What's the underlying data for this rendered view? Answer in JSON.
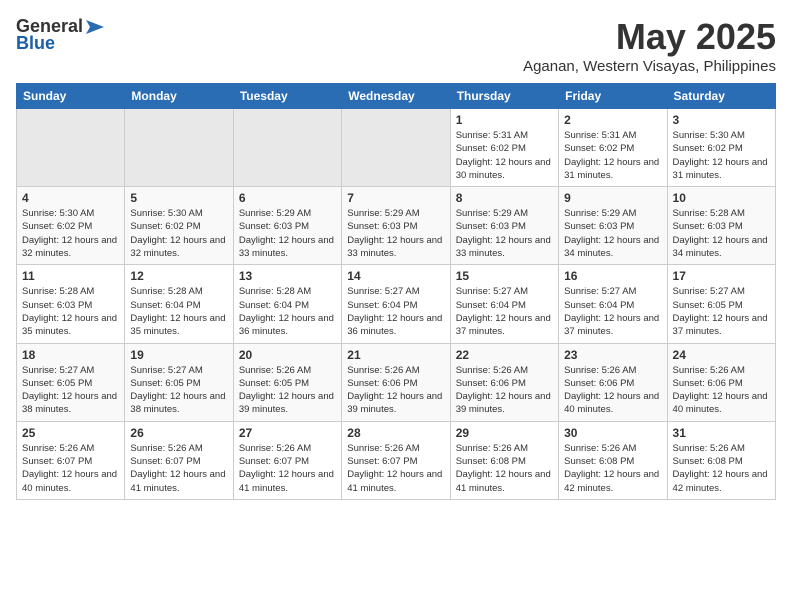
{
  "header": {
    "logo_general": "General",
    "logo_blue": "Blue",
    "month": "May 2025",
    "location": "Aganan, Western Visayas, Philippines"
  },
  "weekdays": [
    "Sunday",
    "Monday",
    "Tuesday",
    "Wednesday",
    "Thursday",
    "Friday",
    "Saturday"
  ],
  "weeks": [
    [
      {
        "day": "",
        "sunrise": "",
        "sunset": "",
        "daylight": "",
        "empty": true
      },
      {
        "day": "",
        "sunrise": "",
        "sunset": "",
        "daylight": "",
        "empty": true
      },
      {
        "day": "",
        "sunrise": "",
        "sunset": "",
        "daylight": "",
        "empty": true
      },
      {
        "day": "",
        "sunrise": "",
        "sunset": "",
        "daylight": "",
        "empty": true
      },
      {
        "day": "1",
        "sunrise": "Sunrise: 5:31 AM",
        "sunset": "Sunset: 6:02 PM",
        "daylight": "Daylight: 12 hours and 30 minutes.",
        "empty": false
      },
      {
        "day": "2",
        "sunrise": "Sunrise: 5:31 AM",
        "sunset": "Sunset: 6:02 PM",
        "daylight": "Daylight: 12 hours and 31 minutes.",
        "empty": false
      },
      {
        "day": "3",
        "sunrise": "Sunrise: 5:30 AM",
        "sunset": "Sunset: 6:02 PM",
        "daylight": "Daylight: 12 hours and 31 minutes.",
        "empty": false
      }
    ],
    [
      {
        "day": "4",
        "sunrise": "Sunrise: 5:30 AM",
        "sunset": "Sunset: 6:02 PM",
        "daylight": "Daylight: 12 hours and 32 minutes.",
        "empty": false
      },
      {
        "day": "5",
        "sunrise": "Sunrise: 5:30 AM",
        "sunset": "Sunset: 6:02 PM",
        "daylight": "Daylight: 12 hours and 32 minutes.",
        "empty": false
      },
      {
        "day": "6",
        "sunrise": "Sunrise: 5:29 AM",
        "sunset": "Sunset: 6:03 PM",
        "daylight": "Daylight: 12 hours and 33 minutes.",
        "empty": false
      },
      {
        "day": "7",
        "sunrise": "Sunrise: 5:29 AM",
        "sunset": "Sunset: 6:03 PM",
        "daylight": "Daylight: 12 hours and 33 minutes.",
        "empty": false
      },
      {
        "day": "8",
        "sunrise": "Sunrise: 5:29 AM",
        "sunset": "Sunset: 6:03 PM",
        "daylight": "Daylight: 12 hours and 33 minutes.",
        "empty": false
      },
      {
        "day": "9",
        "sunrise": "Sunrise: 5:29 AM",
        "sunset": "Sunset: 6:03 PM",
        "daylight": "Daylight: 12 hours and 34 minutes.",
        "empty": false
      },
      {
        "day": "10",
        "sunrise": "Sunrise: 5:28 AM",
        "sunset": "Sunset: 6:03 PM",
        "daylight": "Daylight: 12 hours and 34 minutes.",
        "empty": false
      }
    ],
    [
      {
        "day": "11",
        "sunrise": "Sunrise: 5:28 AM",
        "sunset": "Sunset: 6:03 PM",
        "daylight": "Daylight: 12 hours and 35 minutes.",
        "empty": false
      },
      {
        "day": "12",
        "sunrise": "Sunrise: 5:28 AM",
        "sunset": "Sunset: 6:04 PM",
        "daylight": "Daylight: 12 hours and 35 minutes.",
        "empty": false
      },
      {
        "day": "13",
        "sunrise": "Sunrise: 5:28 AM",
        "sunset": "Sunset: 6:04 PM",
        "daylight": "Daylight: 12 hours and 36 minutes.",
        "empty": false
      },
      {
        "day": "14",
        "sunrise": "Sunrise: 5:27 AM",
        "sunset": "Sunset: 6:04 PM",
        "daylight": "Daylight: 12 hours and 36 minutes.",
        "empty": false
      },
      {
        "day": "15",
        "sunrise": "Sunrise: 5:27 AM",
        "sunset": "Sunset: 6:04 PM",
        "daylight": "Daylight: 12 hours and 37 minutes.",
        "empty": false
      },
      {
        "day": "16",
        "sunrise": "Sunrise: 5:27 AM",
        "sunset": "Sunset: 6:04 PM",
        "daylight": "Daylight: 12 hours and 37 minutes.",
        "empty": false
      },
      {
        "day": "17",
        "sunrise": "Sunrise: 5:27 AM",
        "sunset": "Sunset: 6:05 PM",
        "daylight": "Daylight: 12 hours and 37 minutes.",
        "empty": false
      }
    ],
    [
      {
        "day": "18",
        "sunrise": "Sunrise: 5:27 AM",
        "sunset": "Sunset: 6:05 PM",
        "daylight": "Daylight: 12 hours and 38 minutes.",
        "empty": false
      },
      {
        "day": "19",
        "sunrise": "Sunrise: 5:27 AM",
        "sunset": "Sunset: 6:05 PM",
        "daylight": "Daylight: 12 hours and 38 minutes.",
        "empty": false
      },
      {
        "day": "20",
        "sunrise": "Sunrise: 5:26 AM",
        "sunset": "Sunset: 6:05 PM",
        "daylight": "Daylight: 12 hours and 39 minutes.",
        "empty": false
      },
      {
        "day": "21",
        "sunrise": "Sunrise: 5:26 AM",
        "sunset": "Sunset: 6:06 PM",
        "daylight": "Daylight: 12 hours and 39 minutes.",
        "empty": false
      },
      {
        "day": "22",
        "sunrise": "Sunrise: 5:26 AM",
        "sunset": "Sunset: 6:06 PM",
        "daylight": "Daylight: 12 hours and 39 minutes.",
        "empty": false
      },
      {
        "day": "23",
        "sunrise": "Sunrise: 5:26 AM",
        "sunset": "Sunset: 6:06 PM",
        "daylight": "Daylight: 12 hours and 40 minutes.",
        "empty": false
      },
      {
        "day": "24",
        "sunrise": "Sunrise: 5:26 AM",
        "sunset": "Sunset: 6:06 PM",
        "daylight": "Daylight: 12 hours and 40 minutes.",
        "empty": false
      }
    ],
    [
      {
        "day": "25",
        "sunrise": "Sunrise: 5:26 AM",
        "sunset": "Sunset: 6:07 PM",
        "daylight": "Daylight: 12 hours and 40 minutes.",
        "empty": false
      },
      {
        "day": "26",
        "sunrise": "Sunrise: 5:26 AM",
        "sunset": "Sunset: 6:07 PM",
        "daylight": "Daylight: 12 hours and 41 minutes.",
        "empty": false
      },
      {
        "day": "27",
        "sunrise": "Sunrise: 5:26 AM",
        "sunset": "Sunset: 6:07 PM",
        "daylight": "Daylight: 12 hours and 41 minutes.",
        "empty": false
      },
      {
        "day": "28",
        "sunrise": "Sunrise: 5:26 AM",
        "sunset": "Sunset: 6:07 PM",
        "daylight": "Daylight: 12 hours and 41 minutes.",
        "empty": false
      },
      {
        "day": "29",
        "sunrise": "Sunrise: 5:26 AM",
        "sunset": "Sunset: 6:08 PM",
        "daylight": "Daylight: 12 hours and 41 minutes.",
        "empty": false
      },
      {
        "day": "30",
        "sunrise": "Sunrise: 5:26 AM",
        "sunset": "Sunset: 6:08 PM",
        "daylight": "Daylight: 12 hours and 42 minutes.",
        "empty": false
      },
      {
        "day": "31",
        "sunrise": "Sunrise: 5:26 AM",
        "sunset": "Sunset: 6:08 PM",
        "daylight": "Daylight: 12 hours and 42 minutes.",
        "empty": false
      }
    ]
  ]
}
